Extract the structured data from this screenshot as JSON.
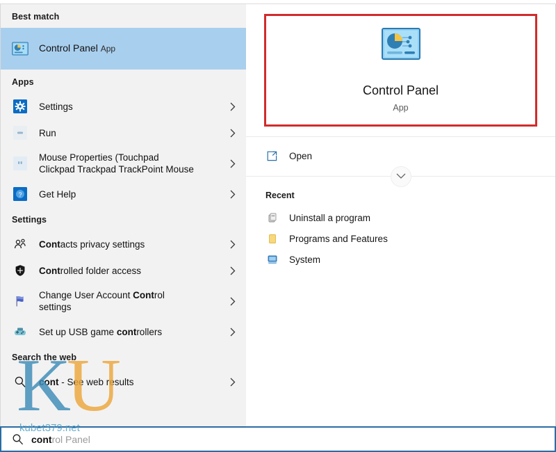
{
  "colors": {
    "selection": "#a9cfee",
    "left_panel_bg": "#f2f2f2",
    "right_panel_bg": "#ffffff",
    "annotation_red": "#d22b2b",
    "search_border": "#2b6ca3",
    "watermark_blue": "#3d8cb8",
    "watermark_orange": "#eda73c"
  },
  "left": {
    "best_match_header": "Best match",
    "best_match": {
      "title": "Control Panel",
      "subtitle": "App",
      "icon": "control-panel-icon"
    },
    "apps_header": "Apps",
    "apps": [
      {
        "label": "Settings",
        "icon": "settings-gear-icon",
        "chevron": "›",
        "match": "",
        "rest": "Settings"
      },
      {
        "label": "Run",
        "icon": "run-icon",
        "chevron": "›",
        "match": "",
        "rest": "Run"
      },
      {
        "label": "Mouse Properties (Touchpad Clickpad Trackpad TrackPoint Mouse",
        "line1": "Mouse Properties (Touchpad",
        "line2": "Clickpad Trackpad TrackPoint Mouse",
        "icon": "mouse-properties-icon",
        "chevron": "›"
      },
      {
        "label": "Get Help",
        "icon": "get-help-icon",
        "chevron": "›",
        "match": "",
        "rest": "Get Help"
      }
    ],
    "settings_header": "Settings",
    "settings": [
      {
        "label": "Contacts privacy settings",
        "match": "Cont",
        "rest": "acts privacy settings",
        "icon": "contacts-icon",
        "chevron": "›"
      },
      {
        "label": "Controlled folder access",
        "match": "Cont",
        "rest": "rolled folder access",
        "icon": "shield-icon",
        "chevron": "›"
      },
      {
        "label": "Change User Account Control settings",
        "line1_pre": "Change User Account ",
        "line1_match": "Cont",
        "line1_post": "rol",
        "line2": "settings",
        "icon": "flag-icon",
        "chevron": "›"
      },
      {
        "label": "Set up USB game controllers",
        "pre": "Set up USB game ",
        "match": "cont",
        "rest": "rollers",
        "icon": "gamepad-icon",
        "chevron": "›"
      }
    ],
    "web_header": "Search the web",
    "web": [
      {
        "query": "cont",
        "suffix": " - See web results",
        "icon": "search-icon",
        "chevron": "›"
      }
    ]
  },
  "right": {
    "hero": {
      "title": "Control Panel",
      "subtitle": "App",
      "icon": "control-panel-icon"
    },
    "actions": [
      {
        "label": "Open",
        "icon": "open-external-icon"
      }
    ],
    "expander_icon": "chevron-down-icon",
    "recent_header": "Recent",
    "recent": [
      {
        "label": "Uninstall a program",
        "icon": "uninstall-program-icon"
      },
      {
        "label": "Programs and Features",
        "icon": "folder-icon"
      },
      {
        "label": "System",
        "icon": "system-icon"
      }
    ]
  },
  "search": {
    "icon": "search-icon",
    "typed": "cont",
    "suggestion": "rol Panel",
    "full_value": "control Panel"
  },
  "watermark": {
    "letter_k": "K",
    "letter_u": "U",
    "url": "kubet379.net"
  }
}
